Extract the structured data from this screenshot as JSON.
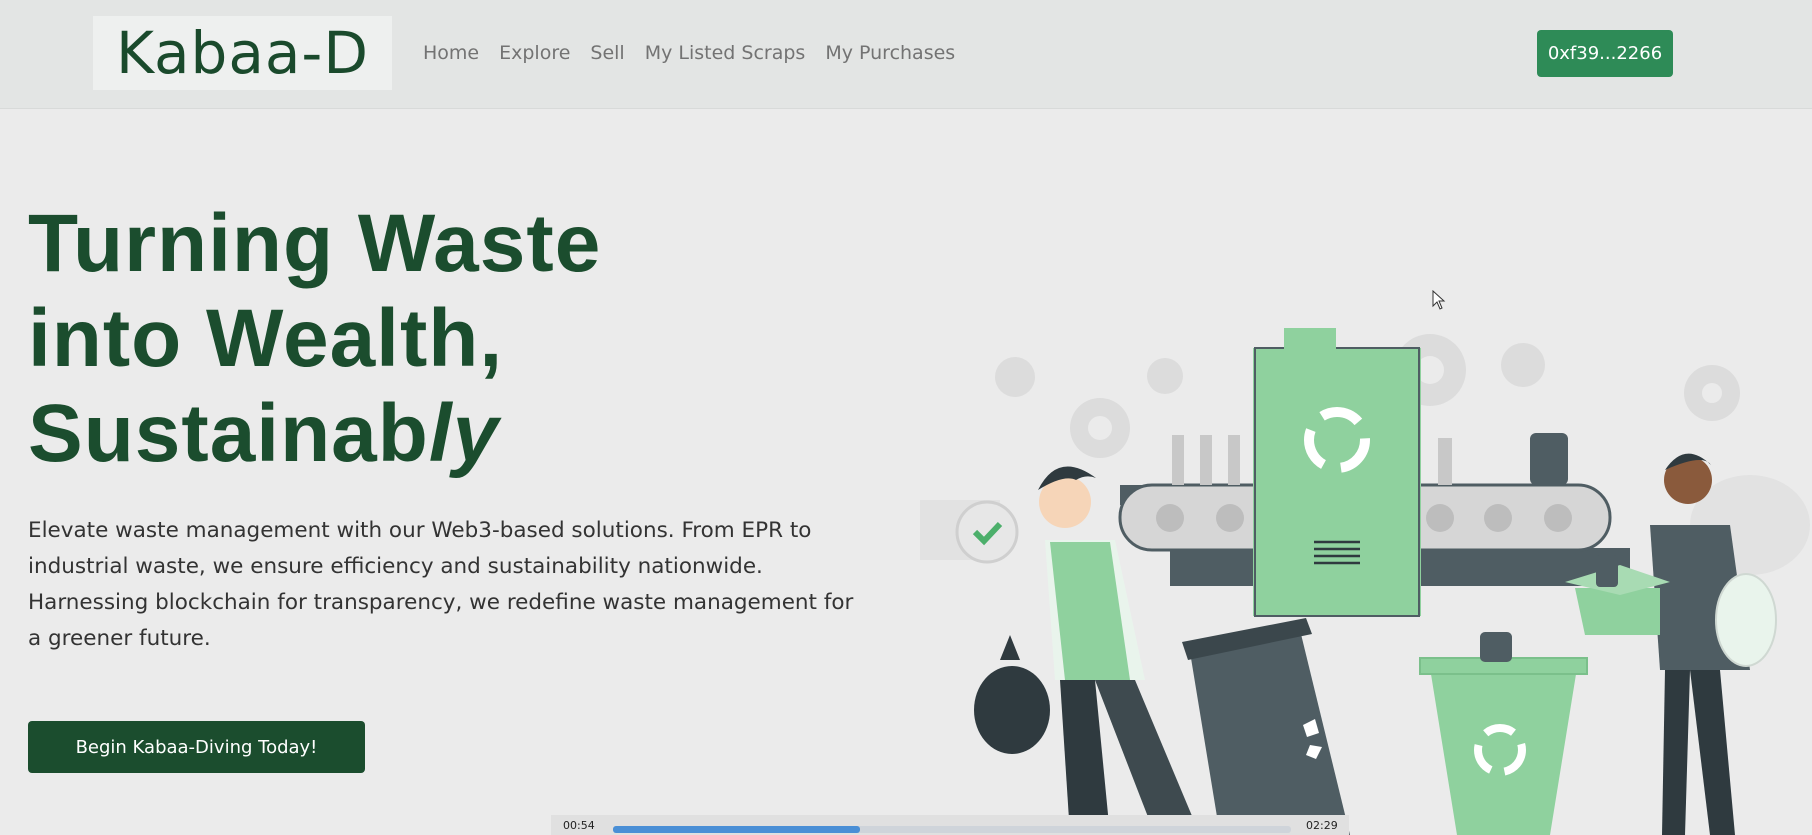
{
  "brand": {
    "logo_text": "Kabaa-D"
  },
  "nav": {
    "items": [
      {
        "label": "Home"
      },
      {
        "label": "Explore"
      },
      {
        "label": "Sell"
      },
      {
        "label": "My Listed Scraps"
      },
      {
        "label": "My Purchases"
      }
    ],
    "wallet_label": "0xf39...2266"
  },
  "hero": {
    "line1": "Turning Waste",
    "line2": "into Wealth,",
    "line3_a": "Sustainab",
    "line3_b": "ly",
    "description": "Elevate waste management with our Web3-based solutions. From EPR to industrial waste, we ensure efficiency and sustainability nationwide. Harnessing blockchain for transparency, we redefine waste management for a greener future.",
    "cta_label": "Begin Kabaa-Diving Today!"
  },
  "media_player": {
    "current_time": "00:54",
    "total_time": "02:29",
    "progress": 0.364
  },
  "colors": {
    "brand_dark": "#1b4d2e",
    "wallet_green": "#2e8b57",
    "illustration_green": "#8fd19e",
    "illustration_gray": "#4f5d63"
  },
  "icons": {
    "illustration": "recycling-workers-illustration",
    "cursor": "mouse-pointer-icon"
  }
}
